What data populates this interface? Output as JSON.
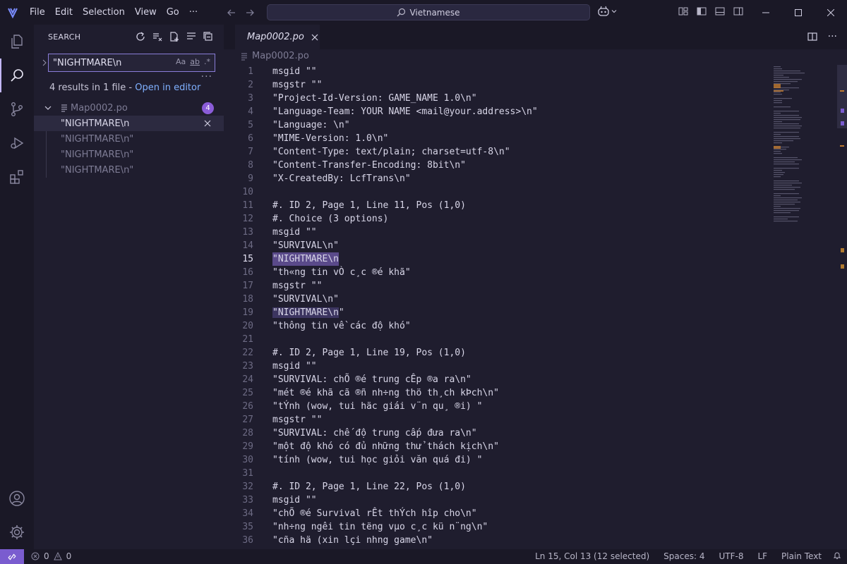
{
  "menu": [
    "File",
    "Edit",
    "Selection",
    "View",
    "Go",
    "···"
  ],
  "command_center": "Vietnamese",
  "sidebar": {
    "title": "SEARCH",
    "query": "\"NIGHTMARE\\n",
    "options": [
      "Aa",
      "ab",
      ".*"
    ],
    "summary": "4 results in 1 file - ",
    "open_in_editor": "Open in editor",
    "file": {
      "name": "Map0002.po",
      "count": "4"
    },
    "matches": [
      "\"NIGHTMARE\\n",
      "\"NIGHTMARE\\n\"",
      "\"NIGHTMARE\\n\"",
      "\"NIGHTMARE\\n\""
    ]
  },
  "tab": {
    "name": "Map0002.po"
  },
  "breadcrumb": "Map0002.po",
  "editor": {
    "current_line": 15,
    "lines": [
      "msgid \"\"",
      "msgstr \"\"",
      "\"Project-Id-Version: GAME_NAME 1.0\\n\"",
      "\"Language-Team: YOUR NAME <mail@your.address>\\n\"",
      "\"Language: \\n\"",
      "\"MIME-Version: 1.0\\n\"",
      "\"Content-Type: text/plain; charset=utf-8\\n\"",
      "\"Content-Transfer-Encoding: 8bit\\n\"",
      "\"X-CreatedBy: LcfTrans\\n\"",
      "",
      "#. ID 2, Page 1, Line 11, Pos (1,0)",
      "#. Choice (3 options)",
      "msgid \"\"",
      "\"SURVIVAL\\n\"",
      "\"NIGHTMARE\\n",
      "\"th«ng tin vÒ c¸c ®é khã\"",
      "msgstr \"\"",
      "\"SURVIVAL\\n\"",
      "\"NIGHTMARE\\n\"",
      "\"thông tin về các độ khó\"",
      "",
      "#. ID 2, Page 1, Line 19, Pos (1,0)",
      "msgid \"\"",
      "\"SURVIVAL: chÕ ®é trung cÊp ®a ra\\n\"",
      "\"mét ®é khã cã ®ñ nh÷ng thö th¸ch kÞch\\n\"",
      "\"tÝnh (wow, tui häc giái v¨n qu¸ ®i) \"",
      "msgstr \"\"",
      "\"SURVIVAL: chế độ trung cấp đưa ra\\n\"",
      "\"một độ khó có đủ những thử thách kịch\\n\"",
      "\"tính (wow, tui học giỏi văn quá đi) \"",
      "",
      "#. ID 2, Page 1, Line 22, Pos (1,0)",
      "msgid \"\"",
      "\"chÕ ®é Survival rÊt thÝch hîp cho\\n\"",
      "\"nh÷ng ngêi tin tëng vµo c¸c kü n¨ng\\n\"",
      "\"cña hä (xin lçi nhng game\\n\""
    ]
  },
  "status": {
    "errors": "0",
    "warnings": "0",
    "position": "Ln 15, Col 13 (12 selected)",
    "spaces": "Spaces: 4",
    "encoding": "UTF-8",
    "eol": "LF",
    "language": "Plain Text"
  },
  "colors": {
    "accent": "#7a5ccf",
    "selection": "#5a4a8a",
    "badge": "#8a5cd8",
    "link": "#7fb0ff"
  }
}
